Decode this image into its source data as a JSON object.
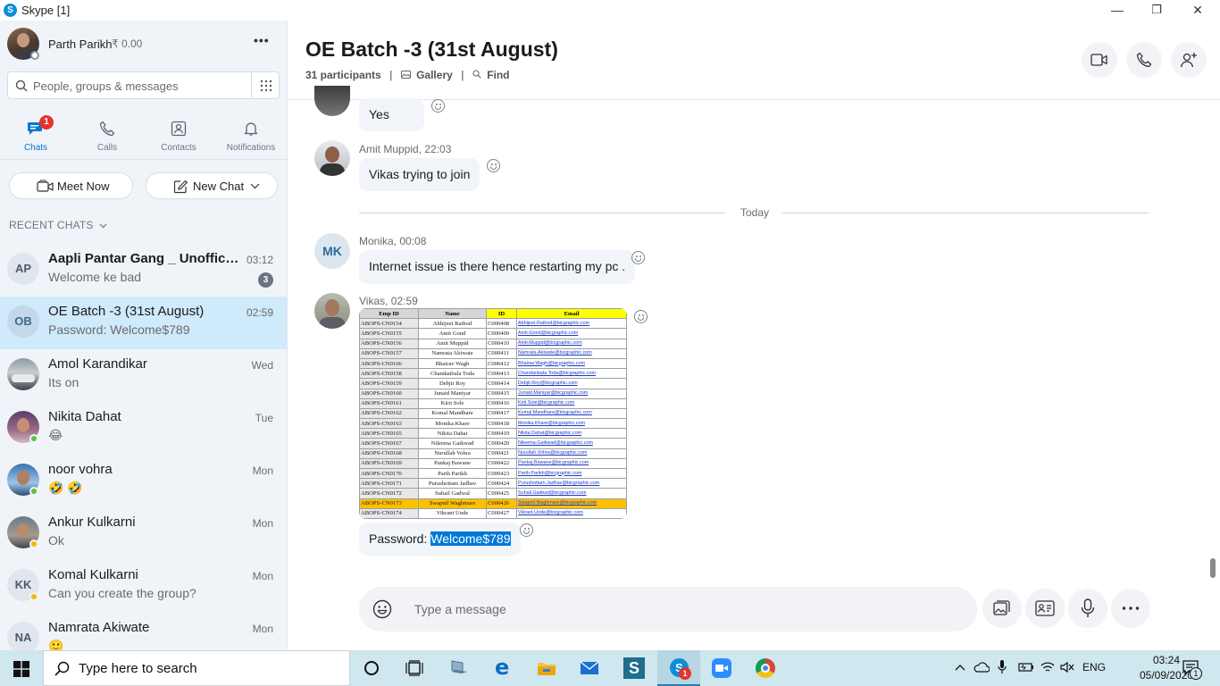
{
  "window": {
    "title": "Skype [1]",
    "minimize": "—",
    "maximize": "❐",
    "close": "✕"
  },
  "profile": {
    "name": "Parth Parikh",
    "credit": "₹ 0.00",
    "more": "•••"
  },
  "search": {
    "placeholder": "People, groups & messages"
  },
  "nav": {
    "tabs": [
      {
        "label": "Chats",
        "badge": "1"
      },
      {
        "label": "Calls"
      },
      {
        "label": "Contacts"
      },
      {
        "label": "Notifications"
      }
    ]
  },
  "actions": {
    "meet_now": "Meet Now",
    "new_chat": "New Chat"
  },
  "recent": {
    "header": "RECENT CHATS",
    "items": [
      {
        "initials": "AP",
        "name": "Aapli Pantar Gang _ Unoffici...",
        "preview": "Welcome ke bad",
        "time": "03:12",
        "badge": "3"
      },
      {
        "initials": "OB",
        "name": "OE Batch -3 (31st August)",
        "preview": "Password: Welcome$789",
        "time": "02:59"
      },
      {
        "name": "Amol Karandikar",
        "preview": "Its on",
        "time": "Wed"
      },
      {
        "name": "Nikita Dahat",
        "preview": "😂",
        "time": "Tue"
      },
      {
        "name": "noor vohra",
        "preview": "🤣 🤣",
        "time": "Mon"
      },
      {
        "name": "Ankur Kulkarni",
        "preview": "Ok",
        "time": "Mon"
      },
      {
        "initials": "KK",
        "name": "Komal Kulkarni",
        "preview": "Can you create the group?",
        "time": "Mon"
      },
      {
        "initials": "NA",
        "name": "Namrata Akiwate",
        "preview": "🙂",
        "time": "Mon"
      }
    ]
  },
  "conversation": {
    "title": "OE Batch -3 (31st August)",
    "participants": "31 participants",
    "gallery": "Gallery",
    "find": "Find",
    "separator": "|"
  },
  "messages": {
    "m1_text": "Yes",
    "m2_sender": "Amit Muppid, 22:03",
    "m2_text": "Vikas trying to join",
    "divider": "Today",
    "m3_initials": "MK",
    "m3_sender": "Monika, 00:08",
    "m3_text": "Internet issue is there hence restarting my pc .",
    "m4_sender": "Vikas, 02:59",
    "m5_prefix": "Password: ",
    "m5_highlight": "Welcome$789"
  },
  "sheet": {
    "headers": [
      "Emp ID",
      "Name",
      "ID",
      "Email"
    ],
    "rows": [
      [
        "ABOPS-CN0154",
        "Abhijeet  Rathod",
        "C000408",
        "Abhijeet.Rathod@bicgraphic.com"
      ],
      [
        "ABOPS-CN0155",
        "Amit  Gond",
        "C000409",
        "Amit.Gond@bicgraphic.com"
      ],
      [
        "ABOPS-CN0156",
        "Amit  Muppid",
        "C000410",
        "Amit.Muppid@bicgraphic.com"
      ],
      [
        "ABOPS-CN0157",
        "Namrata  Akiwate",
        "C000411",
        "Namrata.Akiwate@bicgraphic.com"
      ],
      [
        "ABOPS-CN0166",
        "Bhairav  Wagh",
        "C000412",
        "Bhairav.Wagh@bicgraphic.com"
      ],
      [
        "ABOPS-CN0158",
        "Chandanbala  Toda",
        "C000413",
        "Chandanbala.Toda@bicgraphic.com"
      ],
      [
        "ABOPS-CN0159",
        "Debjit  Roy",
        "C000414",
        "Debjit.Roy@bicgraphic.com"
      ],
      [
        "ABOPS-CN0160",
        "Junaid  Maniyar",
        "C000415",
        "Junaid.Maniyar@bicgraphic.com"
      ],
      [
        "ABOPS-CN0161",
        "Kirti  Sole",
        "C000416",
        "Kirti.Sole@bicgraphic.com"
      ],
      [
        "ABOPS-CN0162",
        "Komal  Mandhare",
        "C000417",
        "Komal.Mandhare@bicgraphic.com"
      ],
      [
        "ABOPS-CN0163",
        "Monika  Khare",
        "C000418",
        "Monika.Khare@bicgraphic.com"
      ],
      [
        "ABOPS-CN0165",
        "Nikita  Dahat",
        "C000419",
        "Nikita.Dahat@bicgraphic.com"
      ],
      [
        "ABOPS-CN0167",
        "Nileema  Gaikwad",
        "C000420",
        "Nileema.Gaikwad@bicgraphic.com"
      ],
      [
        "ABOPS-CN0168",
        "Nurullah  Vohra",
        "C000421",
        "Nurullah.Vohra@bicgraphic.com"
      ],
      [
        "ABOPS-CN0169",
        "Pankaj  Bawane",
        "C000422",
        "Pankaj.Bawane@bicgraphic.com"
      ],
      [
        "ABOPS-CN0170",
        "Parth  Parikh",
        "C000423",
        "Parth.Parikh@bicgraphic.com"
      ],
      [
        "ABOPS-CN0171",
        "Purushottam  Jadhav",
        "C000424",
        "Purushottam.Jadhav@bicgraphic.com"
      ],
      [
        "ABOPS-CN0172",
        "Suhail  Gadwal",
        "C000425",
        "Suhail.Gadwal@bicgraphic.com"
      ],
      [
        "ABOPS-CN0173",
        "Swapnil  Waghmare",
        "C000426",
        "Swapnil.Waghmare@bicgraphic.com"
      ],
      [
        "ABOPS-CN0174",
        "Vikrant  Unde",
        "C000427",
        "Vikrant.Unde@bicgraphic.com"
      ]
    ],
    "highlight_row": 18
  },
  "compose": {
    "placeholder": "Type a message"
  },
  "taskbar": {
    "search_placeholder": "Type here to search",
    "skype_badge": "1",
    "lang": "ENG",
    "time": "03:24",
    "date": "05/09/2020",
    "notif_count": "1"
  },
  "colors": {
    "accent": "#0078d4",
    "badge": "#e3342f",
    "selected": "#cfeafb",
    "sidebar": "#f0f4f9"
  }
}
